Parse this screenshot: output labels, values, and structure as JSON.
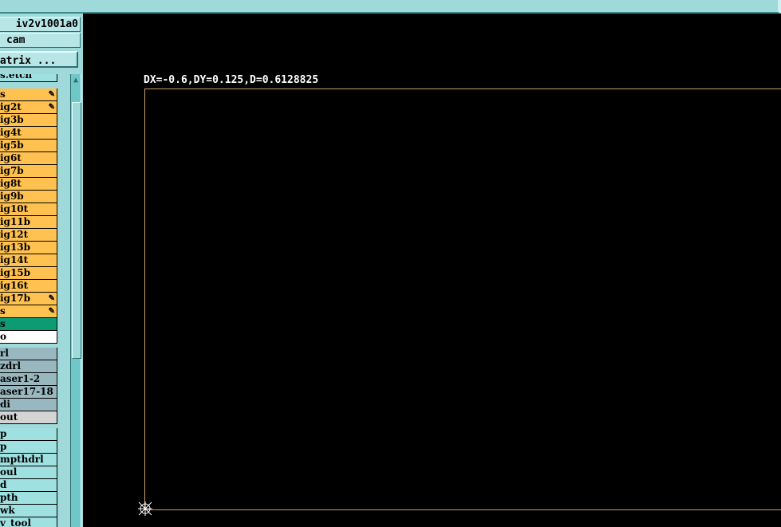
{
  "top_bar": {
    "title": ""
  },
  "left_panel": {
    "job_name": "iv2v1001a0",
    "job_type": "cam",
    "matrix_button": "Matrix ...",
    "partial_top_item": "s.etch",
    "layers": [
      {
        "label": "s",
        "color": "orange",
        "mark": "pencil"
      },
      {
        "label": "ig2t",
        "color": "orange",
        "mark": "pencil"
      },
      {
        "label": "ig3b",
        "color": "orange"
      },
      {
        "label": "ig4t",
        "color": "orange"
      },
      {
        "label": "ig5b",
        "color": "orange"
      },
      {
        "label": "ig6t",
        "color": "orange"
      },
      {
        "label": "ig7b",
        "color": "orange"
      },
      {
        "label": "ig8t",
        "color": "orange"
      },
      {
        "label": "ig9b",
        "color": "orange"
      },
      {
        "label": "ig10t",
        "color": "orange"
      },
      {
        "label": "ig11b",
        "color": "orange"
      },
      {
        "label": "ig12t",
        "color": "orange"
      },
      {
        "label": "ig13b",
        "color": "orange"
      },
      {
        "label": "ig14t",
        "color": "orange"
      },
      {
        "label": "ig15b",
        "color": "orange"
      },
      {
        "label": "ig16t",
        "color": "orange"
      },
      {
        "label": "ig17b",
        "color": "orange",
        "mark": "pencil"
      },
      {
        "label": "s",
        "color": "orange",
        "mark": "pencil"
      },
      {
        "label": "s",
        "color": "green"
      },
      {
        "label": "o",
        "color": "white"
      },
      {
        "label": "rl",
        "color": "gray"
      },
      {
        "label": "zdrl",
        "color": "gray"
      },
      {
        "label": "aser1-2",
        "color": "gray"
      },
      {
        "label": "aser17-18",
        "color": "gray"
      },
      {
        "label": "di",
        "color": "gray"
      },
      {
        "label": "out",
        "color": "lgray"
      },
      {
        "label": "p",
        "color": "cyan"
      },
      {
        "label": "p",
        "color": "cyan"
      },
      {
        "label": "mpthdrl",
        "color": "cyan"
      },
      {
        "label": "oul",
        "color": "cyan"
      },
      {
        "label": "d",
        "color": "cyan"
      },
      {
        "label": "pth",
        "color": "cyan"
      },
      {
        "label": "wk",
        "color": "cyan"
      },
      {
        "label": "v_tool",
        "color": "cyan"
      }
    ]
  },
  "canvas": {
    "measure_readout": "DX=-0.6,DY=0.125,D=0.6128825"
  },
  "colors": {
    "panel": "#9fd9d9",
    "orange": "#ffc14f",
    "green": "#0d9b73",
    "gray": "#99b7bf",
    "cyan": "#9fe0e0",
    "profile_outline": "#c8a06a"
  },
  "icons": {
    "pencil": "pencil-icon",
    "scroll_up": "arrow-up-icon",
    "datum": "datum-crosshair-icon"
  }
}
